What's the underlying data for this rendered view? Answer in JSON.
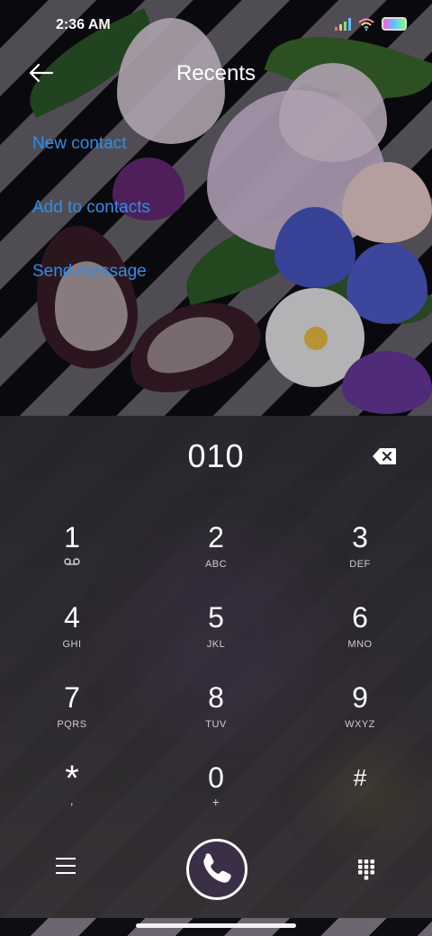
{
  "status_bar": {
    "time": "2:36 AM"
  },
  "header": {
    "title": "Recents"
  },
  "actions": {
    "new_contact": "New contact",
    "add_to_contacts": "Add to contacts",
    "send_message": "Send message"
  },
  "dialer": {
    "entered_number": "010",
    "keys": [
      {
        "digit": "1",
        "letters": ""
      },
      {
        "digit": "2",
        "letters": "ABC"
      },
      {
        "digit": "3",
        "letters": "DEF"
      },
      {
        "digit": "4",
        "letters": "GHI"
      },
      {
        "digit": "5",
        "letters": "JKL"
      },
      {
        "digit": "6",
        "letters": "MNO"
      },
      {
        "digit": "7",
        "letters": "PQRS"
      },
      {
        "digit": "8",
        "letters": "TUV"
      },
      {
        "digit": "9",
        "letters": "WXYZ"
      },
      {
        "digit": "*",
        "letters": ","
      },
      {
        "digit": "0",
        "letters": "+"
      },
      {
        "digit": "#",
        "letters": ""
      }
    ]
  },
  "icons": {
    "back": "back-arrow-icon",
    "delete": "backspace-icon",
    "voicemail": "voicemail-icon",
    "menu": "menu-icon",
    "call": "phone-icon",
    "dialpad": "dialpad-icon"
  },
  "colors": {
    "link": "#2f8ee8",
    "call_button_fill": "#3a2f46"
  }
}
